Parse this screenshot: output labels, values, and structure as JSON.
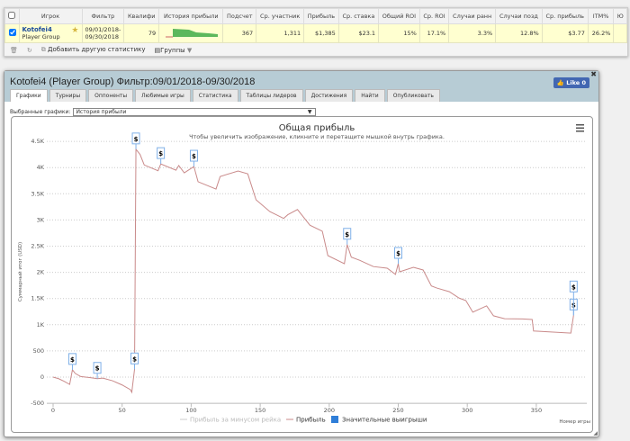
{
  "table": {
    "headers": [
      "Игрок",
      "Фильтр",
      "Квалифи",
      "История прибыли",
      "Подсчет",
      "Ср. участник",
      "Прибыль",
      "Ср. ставка",
      "Общий ROI",
      "Ср. ROI",
      "Случаи ранн",
      "Случаи позд",
      "Ср. прибыль",
      "ITM%",
      "Ю"
    ],
    "row": {
      "player": "Kotofei4",
      "group": "Player Group",
      "filter": "09/01/2018-09/30/2018",
      "qual": "79",
      "count": "367",
      "avg_entrants": "1,311",
      "profit": "$1,385",
      "avg_stake": "$23.1",
      "total_roi": "15%",
      "avg_roi": "17.1%",
      "early": "3.3%",
      "late": "12.8%",
      "avg_profit": "$3.77",
      "itm": "26.2%"
    },
    "toolbar": {
      "add_stat": "Добавить другую статистику",
      "groups": "Группы"
    }
  },
  "panel": {
    "title": "Kotofei4 (Player Group) Фильтр:09/01/2018-09/30/2018",
    "like": "Like 0",
    "tabs": [
      "Графики",
      "Турниры",
      "Оппоненты",
      "Любимые игры",
      "Статистика",
      "Таблицы лидеров",
      "Достижения",
      "Найти",
      "Опубликовать"
    ],
    "select_label": "Выбранные графики:",
    "select_value": "История прибыли"
  },
  "chart_data": {
    "type": "line",
    "title": "Общая прибыль",
    "subtitle": "Чтобы увеличить изображение, кликните и перетащите мышкой внутрь графика.",
    "xlabel": "Номер игры",
    "ylabel": "Суммарный итог (USD)",
    "xlim": [
      0,
      385
    ],
    "ylim": [
      -500,
      4500
    ],
    "xticks": [
      0,
      50,
      100,
      150,
      200,
      250,
      300,
      350
    ],
    "yticks": [
      -500,
      0,
      500,
      1000,
      1500,
      2000,
      2500,
      3000,
      3500,
      4000,
      4500
    ],
    "ytick_labels": [
      "-500",
      "0",
      "500",
      "1K",
      "1.5K",
      "2K",
      "2.5K",
      "3K",
      "3.5K",
      "4K",
      "4.5K"
    ],
    "legend": [
      "Прибыль за минусом рейка",
      "Прибыль",
      "Значительные выигрыши"
    ],
    "series": [
      {
        "name": "Прибыль",
        "color": "#c98a8a",
        "points": [
          [
            0,
            0
          ],
          [
            4,
            -30
          ],
          [
            8,
            -80
          ],
          [
            12,
            -140
          ],
          [
            14,
            140
          ],
          [
            16,
            70
          ],
          [
            20,
            10
          ],
          [
            27,
            -10
          ],
          [
            32,
            -30
          ],
          [
            36,
            -20
          ],
          [
            43,
            -70
          ],
          [
            50,
            -150
          ],
          [
            56,
            -240
          ],
          [
            57,
            -290
          ],
          [
            59,
            150
          ],
          [
            60,
            4350
          ],
          [
            63,
            4250
          ],
          [
            66,
            4050
          ],
          [
            76,
            3940
          ],
          [
            78,
            4070
          ],
          [
            89,
            3950
          ],
          [
            91,
            4040
          ],
          [
            95,
            3900
          ],
          [
            102,
            4020
          ],
          [
            105,
            3730
          ],
          [
            118,
            3590
          ],
          [
            121,
            3830
          ],
          [
            134,
            3935
          ],
          [
            141,
            3880
          ],
          [
            147,
            3385
          ],
          [
            157,
            3160
          ],
          [
            167,
            3030
          ],
          [
            170,
            3100
          ],
          [
            177,
            3200
          ],
          [
            186,
            2900
          ],
          [
            195,
            2785
          ],
          [
            198,
            2440
          ],
          [
            199,
            2320
          ],
          [
            211,
            2165
          ],
          [
            213,
            2530
          ],
          [
            216,
            2290
          ],
          [
            222,
            2230
          ],
          [
            232,
            2110
          ],
          [
            242,
            2080
          ],
          [
            248,
            1960
          ],
          [
            250,
            2165
          ],
          [
            251,
            2010
          ],
          [
            261,
            2095
          ],
          [
            268,
            2045
          ],
          [
            274,
            1740
          ],
          [
            278,
            1700
          ],
          [
            287,
            1630
          ],
          [
            294,
            1510
          ],
          [
            299,
            1460
          ],
          [
            304,
            1240
          ],
          [
            314,
            1360
          ],
          [
            319,
            1170
          ],
          [
            327,
            1115
          ],
          [
            340,
            1110
          ],
          [
            347,
            1100
          ],
          [
            348,
            880
          ],
          [
            375,
            840
          ],
          [
            377,
            1180
          ]
        ]
      }
    ],
    "big_wins": [
      14,
      32,
      59,
      60,
      78,
      102,
      213,
      250,
      377,
      377
    ],
    "big_win_symbol": "$"
  }
}
